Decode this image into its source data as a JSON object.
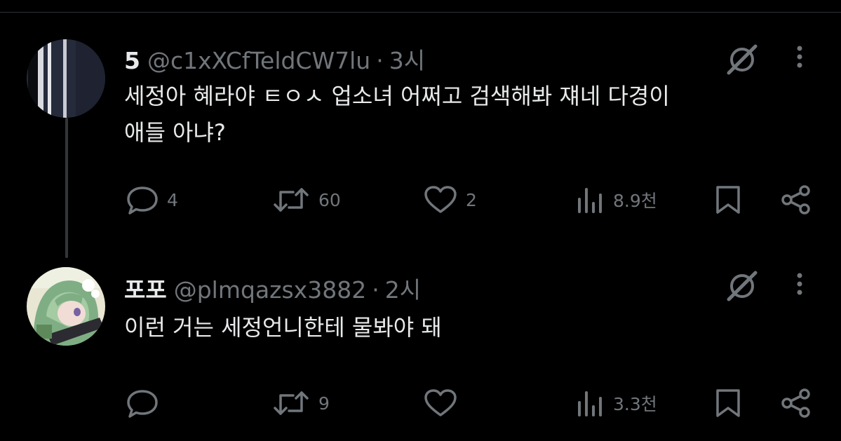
{
  "tweets": [
    {
      "display_name": "5",
      "handle": "@c1xXCfTeldCW7lu",
      "separator": "·",
      "time": "3시",
      "text_lines": [
        "세정아 혜라야 ㅌㅇㅅ 업소녀 어쩌고 검색해봐 쟤네 다경이",
        "애들 아냐?"
      ],
      "actions": {
        "replies": "4",
        "reposts": "60",
        "likes": "2",
        "views": "8.9천"
      },
      "icons": {
        "grok": "grok-slash-icon",
        "more": "more-dots-icon",
        "reply": "comment-bubble-icon",
        "repost": "repost-arrows-icon",
        "like": "heart-icon",
        "views": "bar-chart-icon",
        "bookmark": "bookmark-icon",
        "share": "share-icon"
      }
    },
    {
      "display_name": "포포",
      "handle": "@plmqazsx3882",
      "separator": "·",
      "time": "2시",
      "text_lines": [
        "이런 거는 세정언니한테 물봐야 돼"
      ],
      "actions": {
        "replies": "",
        "reposts": "9",
        "likes": "",
        "views": "3.3천"
      },
      "icons": {
        "grok": "grok-slash-icon",
        "more": "more-dots-icon",
        "reply": "comment-bubble-icon",
        "repost": "repost-arrows-icon",
        "like": "heart-icon",
        "views": "bar-chart-icon",
        "bookmark": "bookmark-icon",
        "share": "share-icon"
      }
    }
  ],
  "colors": {
    "background": "#000000",
    "text": "#e7e9ea",
    "muted": "#71767b",
    "divider": "#2f3336"
  }
}
